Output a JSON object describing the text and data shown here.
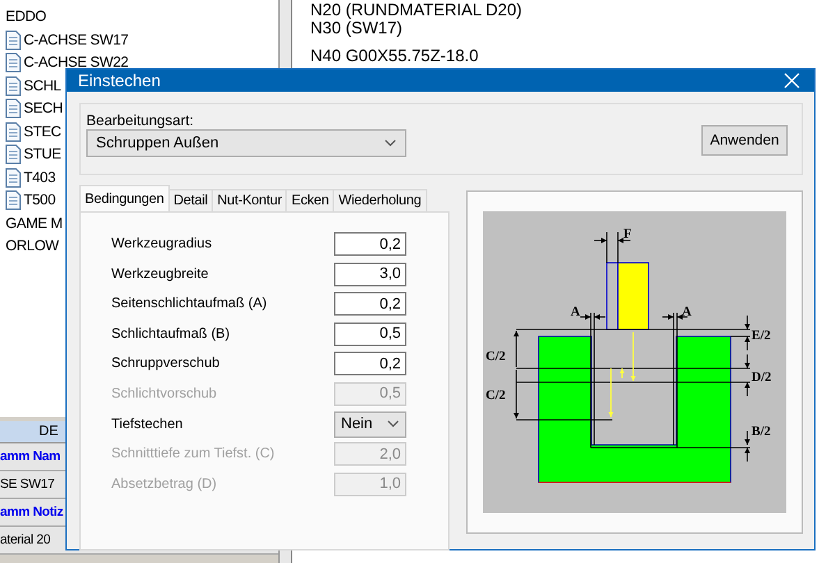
{
  "tree_items": [
    {
      "label": "EDDO",
      "kind": "folder"
    },
    {
      "label": "C-ACHSE SW17",
      "kind": "file"
    },
    {
      "label": "C-ACHSE SW22",
      "kind": "file"
    },
    {
      "label": "SCHL",
      "kind": "file"
    },
    {
      "label": "SECH",
      "kind": "file"
    },
    {
      "label": "STEC",
      "kind": "file"
    },
    {
      "label": "STUE",
      "kind": "file"
    },
    {
      "label": "T403",
      "kind": "file"
    },
    {
      "label": "T500",
      "kind": "file"
    },
    {
      "label": "GAME M",
      "kind": "folder"
    },
    {
      "label": "ORLOW",
      "kind": "folder"
    }
  ],
  "info_table": {
    "header": "DE",
    "rows": [
      {
        "text": "amm Nam",
        "kind": "caption"
      },
      {
        "text": "SE SW17",
        "kind": "value"
      },
      {
        "text": "amm Notiz",
        "kind": "caption"
      },
      {
        "text": "aterial 20",
        "kind": "value"
      }
    ]
  },
  "code_blocks": [
    [
      "N20 (RUNDMATERIAL D20)",
      "N30 (SW17)"
    ],
    [
      "N40 G00X55.75Z-18.0"
    ]
  ],
  "dialog": {
    "title": "Einstechen",
    "group_label": "Bearbeitungsart:",
    "mode_select": "Schruppen Außen",
    "apply_button": "Anwenden",
    "tabs": [
      {
        "label": "Bedingungen",
        "selected": true
      },
      {
        "label": "Detail",
        "selected": false
      },
      {
        "label": "Nut-Kontur",
        "selected": false
      },
      {
        "label": "Ecken",
        "selected": false
      },
      {
        "label": "Wiederholung",
        "selected": false
      }
    ],
    "fields": [
      {
        "label": "Werkzeugradius",
        "value": "0,2",
        "kind": "input",
        "disabled": false
      },
      {
        "label": "Werkzeugbreite",
        "value": "3,0",
        "kind": "input",
        "disabled": false
      },
      {
        "label": "Seitenschlichtaufmaß (A)",
        "value": "0,2",
        "kind": "input",
        "disabled": false
      },
      {
        "label": "Schlichtaufmaß (B)",
        "value": "0,5",
        "kind": "input",
        "disabled": false
      },
      {
        "label": "Schruppverschub",
        "value": "0,2",
        "kind": "input",
        "disabled": false
      },
      {
        "label": "Schlichtvorschub",
        "value": "0,5",
        "kind": "input",
        "disabled": true
      },
      {
        "label": "Tiefstechen",
        "value": "Nein",
        "kind": "select",
        "disabled": false
      },
      {
        "label": "Schnitttiefe zum Tiefst. (C)",
        "value": "2,0",
        "kind": "input",
        "disabled": true
      },
      {
        "label": "Absetzbetrag (D)",
        "value": "1,0",
        "kind": "input",
        "disabled": true
      }
    ],
    "diagram_labels": [
      "F",
      "A",
      "A",
      "E/2",
      "C/2",
      "D/2",
      "C/2",
      "B/2"
    ]
  }
}
